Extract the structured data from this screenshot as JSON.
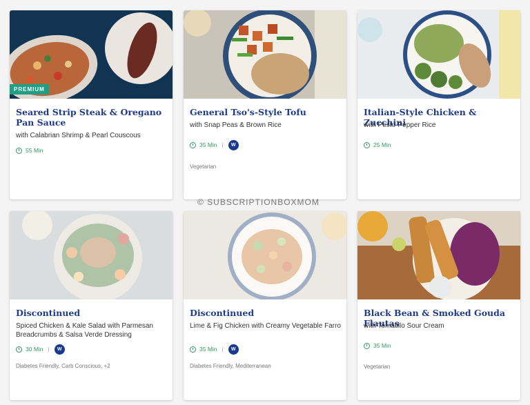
{
  "watermark": "© SUBSCRIPTIONBOXMOM",
  "colors": {
    "title": "#1e3a8a",
    "time": "#2f9a62",
    "premium_badge": "#1f9f84",
    "ww_badge": "#1a3a8f"
  },
  "cards": [
    {
      "title": "Seared Strip Steak & Oregano Pan Sauce",
      "subtitle": "with Calabrian Shrimp & Pearl Couscous",
      "badge": "PREMIUM",
      "time": "55 Min",
      "tags": ""
    },
    {
      "title": "General Tso's-Style Tofu",
      "subtitle": "with Snap Peas & Brown Rice",
      "badge": "",
      "time": "35 Min",
      "ww_label": "W",
      "tags": "Vegetarian"
    },
    {
      "title": "Italian-Style Chicken & Zucchini",
      "subtitle": "with Pesto-Pepper Rice",
      "badge": "",
      "time": "25 Min",
      "tags": ""
    },
    {
      "title": "Discontinued",
      "subtitle": "Spiced Chicken & Kale Salad with Parmesan Breadcrumbs & Salsa Verde Dressing",
      "badge": "",
      "time": "30 Min",
      "ww_label": "W",
      "tags": "Diabetes Friendly, Carb Conscious, +2"
    },
    {
      "title": "Discontinued",
      "subtitle": "Lime & Fig Chicken with Creamy Vegetable Farro",
      "badge": "",
      "time": "35 Min",
      "ww_label": "W",
      "tags": "Diabetes Friendly, Mediterranean"
    },
    {
      "title": "Black Bean & Smoked Gouda Flautas",
      "subtitle": "with Tomatillo Sour Cream",
      "badge": "",
      "time": "35 Min",
      "tags": "Vegetarian"
    }
  ]
}
